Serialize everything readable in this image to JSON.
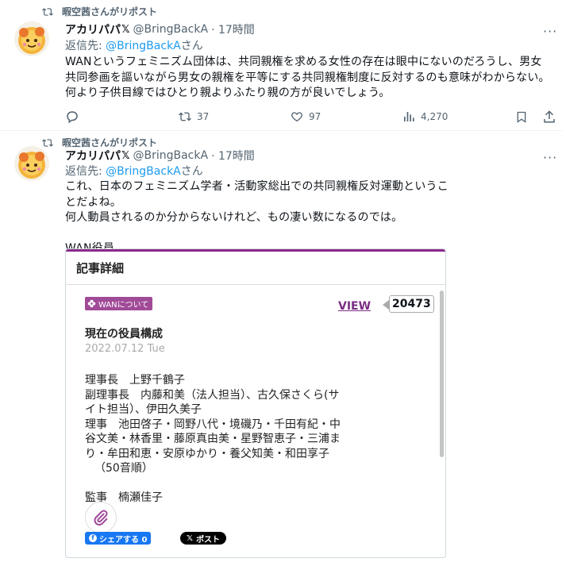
{
  "tweets": [
    {
      "reposted_by": "暇空茜さんがリポスト",
      "name": "アカリパパ",
      "handle": "@BringBackA",
      "time": "· 17時間",
      "reply_prefix": "返信先: ",
      "reply_handle": "@BringBackA",
      "reply_suffix": "さん",
      "text": "WANというフェミニズム団体は、共同親権を求める女性の存在は眼中にないのだろうし、男女共同参画を謳いながら男女の親権を平等にする共同親権制度に反対するのも意味がわからない。何より子供目線ではひとり親よりふたり親の方が良いでしょう。",
      "retweets": "37",
      "likes": "97",
      "views": "4,270"
    },
    {
      "reposted_by": "暇空茜さんがリポスト",
      "name": "アカリパパ",
      "handle": "@BringBackA",
      "time": "· 17時間",
      "reply_prefix": "返信先: ",
      "reply_handle": "@BringBackA",
      "reply_suffix": "さん",
      "text_lines": [
        "これ、日本のフェミニズム学者・活動家総出での共同親権反対運動というこ",
        "とだよね。",
        "何人動員されるのか分からないけれど、もの凄い数になるのでは。",
        "",
        "WAN役員"
      ]
    }
  ],
  "card": {
    "header": "記事詳細",
    "tag": "WANについて",
    "view_label": "VIEW",
    "view_count": "20473",
    "title": "現在の役員構成",
    "date": "2022.07.12 Tue",
    "body_lines": [
      "理事長　上野千鶴子",
      "副理事長　内藤和美（法人担当）、古久保さくら(サ",
      "イト担当）、伊田久美子",
      "理事　池田啓子・岡野八代・境磯乃・千田有紀・中",
      "谷文美・林香里・藤原真由美・星野智恵子・三浦ま",
      "り・牟田和恵・安原ゆかり・養父知美・和田享子",
      "（50音順）",
      "",
      "監事　楠瀬佳子"
    ],
    "fb_label": "シェアする 0",
    "x_label": "ポスト"
  },
  "colors": {
    "accent": "#1d9bf0",
    "muted": "#536471",
    "wan_purple": "#8b2a8b"
  }
}
